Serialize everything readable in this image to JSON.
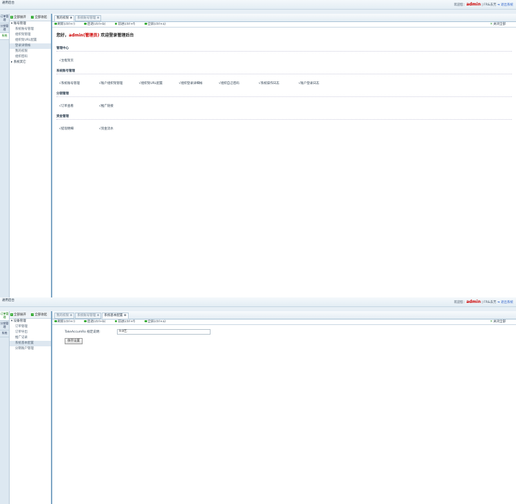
{
  "shot1": {
    "app_title": "通用后台",
    "welcome_prefix": "欢迎您：",
    "username": "admin",
    "user_links": "| FR&去芳",
    "logout": "➜ 退出系统",
    "vtabs": [
      "订单管理",
      "分销管理",
      "系统"
    ],
    "sidebar_buttons": [
      "全部展开",
      "全部收起"
    ],
    "tree": [
      {
        "label": "▾ 账号管理",
        "type": "grp"
      },
      {
        "label": "系统账号管理",
        "type": "item"
      },
      {
        "label": "组织架管理",
        "type": "item"
      },
      {
        "label": "组织架URL配置",
        "type": "item"
      },
      {
        "label": "登录详情帐",
        "type": "sel"
      },
      {
        "label": "我的权限",
        "type": "item"
      },
      {
        "label": "组织密码",
        "type": "item"
      },
      {
        "label": "▸ 系统其它",
        "type": "grp"
      }
    ],
    "tabs": [
      "我的权限 ⊗",
      "系统账号管理 ⊗"
    ],
    "toolbar": [
      "刷新(ctrl+r)",
      "后退(ctrl+b)",
      "前进(ctrl+f)",
      "全屏(ctrl+a)"
    ],
    "close_all": "关闭全部",
    "welcome_text_a": "您好，",
    "welcome_user": "admin(管理员)",
    "welcome_text_b": "欢迎登录管理后台",
    "sections": [
      {
        "title": "管理中心",
        "items": [
          "√主框架页"
        ]
      },
      {
        "title": "系统账号管理",
        "items": [
          "√系统账号管理",
          "√账户组织架管理",
          "√组织架URL配置",
          "√组织登录详细帐",
          "√组织自己密码",
          "√系统操作日志",
          "√账户登录日志"
        ]
      },
      {
        "title": "分销管理",
        "items": [
          "√订单查看",
          "√推广链接"
        ]
      },
      {
        "title": "资金管理",
        "items": [
          "√提现明细",
          "√资金流水"
        ]
      }
    ]
  },
  "shot2": {
    "app_title": "通用后台",
    "welcome_prefix": "欢迎您：",
    "username": "admin",
    "user_links": "| FR&去芳",
    "logout": "➜ 退出系统",
    "vtabs": [
      "订单管理",
      "分销管理",
      "系统"
    ],
    "sidebar_buttons": [
      "全部展开",
      "全部收起"
    ],
    "tree": [
      {
        "label": "▾ 设备管理",
        "type": "grp"
      },
      {
        "label": "订单管理",
        "type": "item"
      },
      {
        "label": "订单导出",
        "type": "item"
      },
      {
        "label": "推广记录",
        "type": "item"
      },
      {
        "label": "系统基本配置",
        "type": "sel"
      },
      {
        "label": "分销账户管理",
        "type": "item"
      }
    ],
    "tabs": [
      "我的权限 ⊗",
      "系统账号管理 ⊗",
      "系统基本配置 ⊗"
    ],
    "toolbar": [
      "刷新(ctrl+r)",
      "后退(ctrl+b)",
      "前进(ctrl+f)",
      "全屏(ctrl+a)"
    ],
    "close_all": "关闭全部",
    "form_label": "TakeAccumRo 规定说明:",
    "form_value": "9.8乞",
    "save_button": "保存设置"
  }
}
